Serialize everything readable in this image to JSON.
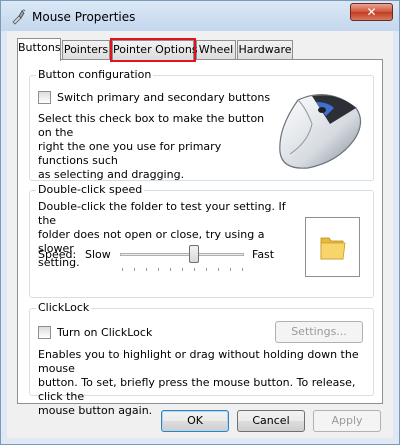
{
  "window": {
    "title": "Mouse Properties",
    "close_label": "✕"
  },
  "tabs": [
    {
      "label": "Buttons"
    },
    {
      "label": "Pointers"
    },
    {
      "label": "Pointer Options"
    },
    {
      "label": "Wheel"
    },
    {
      "label": "Hardware"
    }
  ],
  "button_configuration": {
    "title": "Button configuration",
    "checkbox_label": "Switch primary and secondary buttons",
    "checked": false,
    "description_lines": [
      "Select this check box to make the button on the",
      "right the one you use for primary functions such",
      "as selecting and dragging."
    ]
  },
  "double_click": {
    "title": "Double-click speed",
    "description_lines": [
      "Double-click the folder to test your setting.  If the",
      "folder does not open or close, try using a slower",
      "setting."
    ],
    "speed_label": "Speed:",
    "slow_label": "Slow",
    "fast_label": "Fast",
    "speed_value": 0.6
  },
  "clicklock": {
    "title": "ClickLock",
    "checkbox_label": "Turn on ClickLock",
    "checked": false,
    "settings_label": "Settings...",
    "description_lines": [
      "Enables you to highlight or drag without holding down the mouse",
      "button. To set, briefly press the mouse button. To release, click the",
      "mouse button again."
    ]
  },
  "footer": {
    "ok_label": "OK",
    "cancel_label": "Cancel",
    "apply_label": "Apply"
  },
  "colors": {
    "highlight_outline": "#e0141e",
    "folder": "#f2c94c"
  }
}
